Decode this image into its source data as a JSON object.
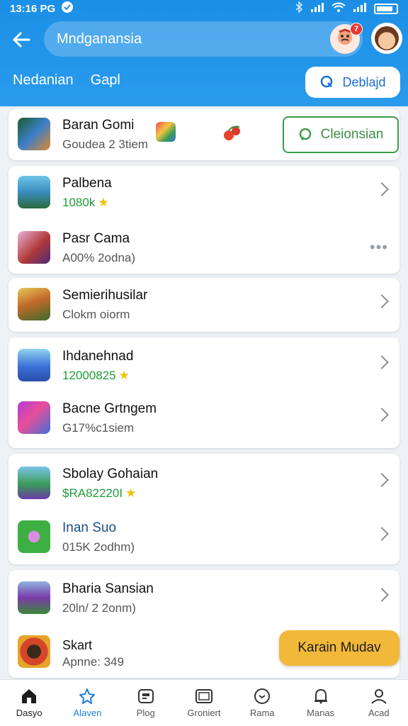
{
  "status_bar": {
    "time": "13:16 PG"
  },
  "header": {
    "search_text": "Mndganansia",
    "notification_count": "7",
    "tabs": [
      "Nedanian",
      "Gapl"
    ],
    "download_button": "Deblajd"
  },
  "featured": {
    "title": "Baran Gomi",
    "subtitle": "Goudea 2 3tiem",
    "action_button": "Cleionsian"
  },
  "cards": [
    {
      "items": [
        {
          "title": "Palbena",
          "subtitle": "1080k",
          "starred": true
        },
        {
          "title": "Pasr Cama",
          "subtitle": "A00% 2odna)"
        }
      ]
    },
    {
      "items": [
        {
          "title": "Semierihusilar",
          "subtitle": "Clokm oiorm"
        }
      ]
    },
    {
      "items": [
        {
          "title": "Ihdanehnad",
          "subtitle": "12000825",
          "starred": true
        },
        {
          "title": "Bacne Grtngem",
          "subtitle": "G17%c1siem"
        }
      ]
    },
    {
      "items": [
        {
          "title": "Sbolay Gohaian",
          "subtitle": "$RA82220I",
          "starred": true
        },
        {
          "title": "Inan Suo",
          "subtitle": "015K 2odhm)"
        }
      ]
    },
    {
      "items": [
        {
          "title": "Bharia Sansian",
          "subtitle": "20ln/ 2 2onm)"
        },
        {
          "title": "Skart",
          "subtitle": "Apnne: 349",
          "button": "Karain Mudav"
        }
      ]
    }
  ],
  "bottom_nav": [
    {
      "label": "Dasyo",
      "icon": "home-icon"
    },
    {
      "label": "Alaven",
      "icon": "star-icon"
    },
    {
      "label": "Plog",
      "icon": "game-icon"
    },
    {
      "label": "Groniert",
      "icon": "screen-icon"
    },
    {
      "label": "Rama",
      "icon": "chat-icon"
    },
    {
      "label": "Manas",
      "icon": "bell-icon"
    },
    {
      "label": "Acad",
      "icon": "person-icon"
    }
  ],
  "colors": {
    "primary": "#1b8fe6",
    "green": "#1f9d3a",
    "yellow": "#f2b83a",
    "star": "#f2c200"
  }
}
